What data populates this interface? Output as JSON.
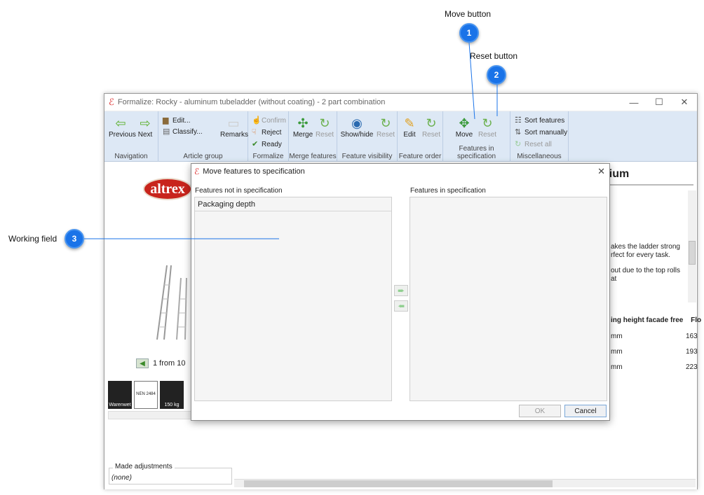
{
  "callouts": [
    {
      "number": "1",
      "label": "Move button"
    },
    {
      "number": "2",
      "label": "Reset button"
    },
    {
      "number": "3",
      "label": "Working field"
    }
  ],
  "window": {
    "title": "Formalize: Rocky - aluminum tubeladder (without coating) - 2 part combination",
    "controls": {
      "minimize": "—",
      "maximize": "☐",
      "close": "✕"
    }
  },
  "ribbon": {
    "navigation": {
      "label": "Navigation",
      "previous": "Previous",
      "next": "Next"
    },
    "article_group": {
      "label": "Article group",
      "edit": "Edit...",
      "classify": "Classify...",
      "remarks": "Remarks"
    },
    "formalize": {
      "label": "Formalize",
      "confirm": "Confirm",
      "reject": "Reject",
      "ready": "Ready"
    },
    "merge_features": {
      "label": "Merge features",
      "merge": "Merge",
      "reset": "Reset"
    },
    "feature_visibility": {
      "label": "Feature visibility",
      "show_hide": "Show/hide",
      "reset": "Reset"
    },
    "feature_order": {
      "label": "Feature order",
      "edit": "Edit",
      "reset": "Reset"
    },
    "features_in_spec": {
      "label": "Features in specification",
      "move": "Move",
      "reset": "Reset"
    },
    "miscellaneous": {
      "label": "Miscellaneous",
      "sort_features": "Sort features",
      "sort_manually": "Sort manually",
      "reset_all": "Reset all"
    }
  },
  "content": {
    "logo_text": "altrex",
    "pager_text": "1 from 10",
    "certs": [
      "Warenwet",
      "NEN 2484",
      "150 kg"
    ],
    "heading_fragment": "nium",
    "description_fragment": [
      "akes the ladder strong",
      "rfect for every task.",
      "",
      "out due to the top rolls at"
    ],
    "table_header": [
      "ing height facade free",
      "Flo"
    ],
    "table_rows": [
      [
        "mm",
        "163"
      ],
      [
        "mm",
        "193"
      ],
      [
        "mm",
        "223"
      ]
    ],
    "made_adjustments": {
      "legend": "Made adjustments",
      "value": "(none)"
    }
  },
  "dialog": {
    "title": "Move features to specification",
    "left_label": "Features not in specification",
    "right_label": "Features in specification",
    "left_items": [
      "Packaging depth"
    ],
    "right_items": [],
    "ok": "OK",
    "cancel": "Cancel"
  },
  "colors": {
    "callout": "#1a73e8",
    "ribbon_bg": "#dde8f5",
    "logo_red": "#c8241c"
  }
}
